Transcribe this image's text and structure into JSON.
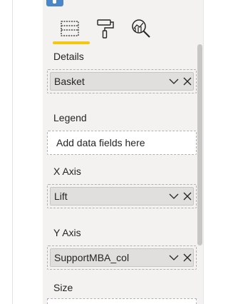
{
  "tabs": [
    {
      "name": "Fields",
      "icon": "fields-icon",
      "active": true
    },
    {
      "name": "Format",
      "icon": "paint-roller-icon",
      "active": false
    },
    {
      "name": "Analytics",
      "icon": "analytics-magnifier-icon",
      "active": false
    }
  ],
  "accent_color": "#f2c811",
  "sections": {
    "details": {
      "label": "Details",
      "field": "Basket"
    },
    "legend": {
      "label": "Legend",
      "placeholder": "Add data fields here"
    },
    "x_axis": {
      "label": "X Axis",
      "field": "Lift"
    },
    "y_axis": {
      "label": "Y Axis",
      "field": "SupportMBA_col"
    },
    "size": {
      "label": "Size"
    }
  }
}
